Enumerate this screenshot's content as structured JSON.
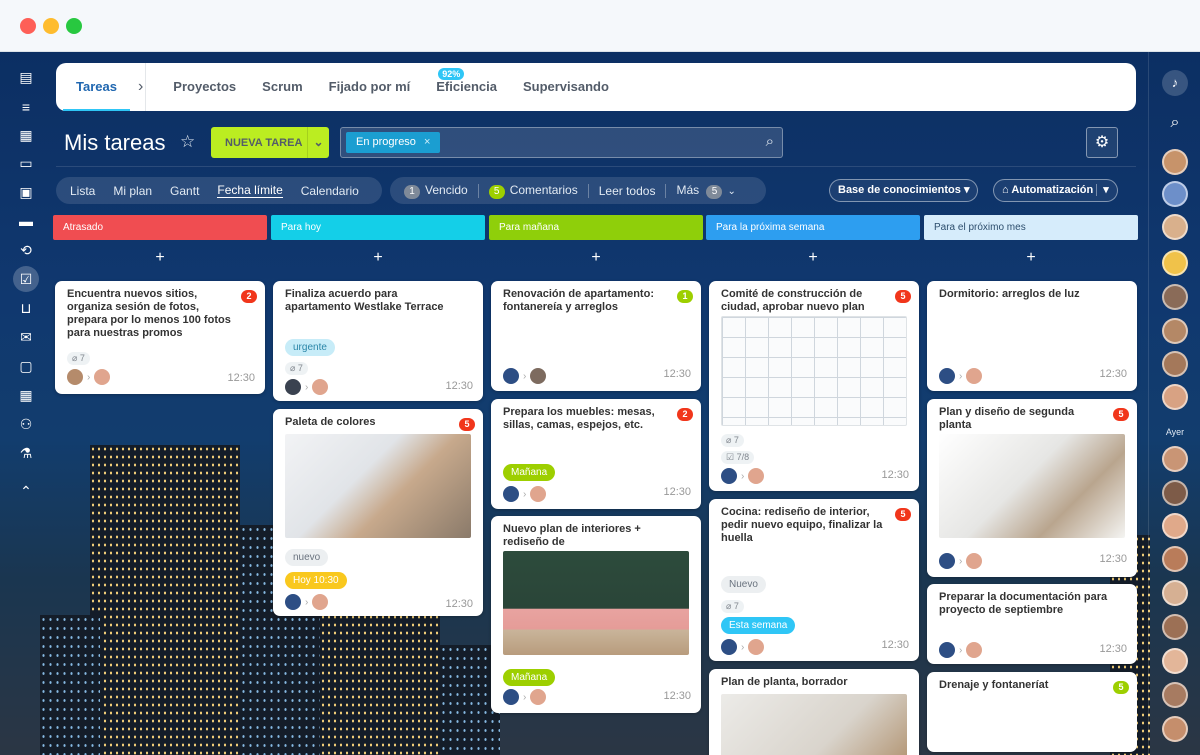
{
  "tabs": [
    {
      "label": "Tareas"
    },
    {
      "label": "Proyectos"
    },
    {
      "label": "Scrum"
    },
    {
      "label": "Fijado por mí"
    },
    {
      "label": "Eficiencia",
      "badge": "92%"
    },
    {
      "label": "Supervisando"
    }
  ],
  "header": {
    "title": "Mis tareas",
    "new_task": "NUEVA TAREA"
  },
  "search": {
    "chip": "En progreso"
  },
  "views": [
    "Lista",
    "Mi plan",
    "Gantt",
    "Fecha límite",
    "Calendario"
  ],
  "counters": {
    "vencido_count": "1",
    "vencido": "Vencido",
    "comentarios_count": "5",
    "comentarios": "Comentarios",
    "leer": "Leer todos",
    "mas": "Más",
    "mas_count": "5"
  },
  "buttons": {
    "kb": "Base de conocimientos",
    "auto": "Automatización"
  },
  "right_sidebar": {
    "label": "Ayer"
  },
  "columns": [
    {
      "title": "Atrasado",
      "color": "#f04d51"
    },
    {
      "title": "Para hoy",
      "color": "#14cfe8"
    },
    {
      "title": "Para mañana",
      "color": "#8fcf0a"
    },
    {
      "title": "Para la próxima semana",
      "color": "#2d9ef0"
    },
    {
      "title": "Para el próximo mes",
      "color": "#d6ecfb"
    }
  ],
  "cards": {
    "c1": {
      "title": "Encuentra nuevos sitios, organiza sesión de fotos, prepara por lo menos 100 fotos para nuestras promos",
      "count": "2",
      "attach": "7",
      "time": "12:30"
    },
    "c2": {
      "title": "Finaliza acuerdo para apartamento Westlake Terrace",
      "tag": "urgente",
      "attach": "7",
      "time": "12:30"
    },
    "c3": {
      "title": "Paleta de colores",
      "count": "5",
      "tag": "nuevo",
      "tag2": "Hoy 10:30",
      "time": "12:30"
    },
    "c4": {
      "title": "Renovación de apartamento: fontanereía y arreglos",
      "count": "1",
      "time": "12:30"
    },
    "c5": {
      "title": "Prepara los muebles: mesas, sillas, camas, espejos, etc.",
      "count": "2",
      "tag": "Mañana",
      "time": "12:30"
    },
    "c6": {
      "title": "Nuevo plan de interiores + rediseño de",
      "tag": "Mañana",
      "time": "12:30"
    },
    "c7": {
      "title": "Comité de construcción de ciudad, aprobar nuevo plan",
      "count": "5",
      "attach": "7",
      "check": "7/8",
      "time": "12:30"
    },
    "c8": {
      "title": "Cocina: rediseño de interior, pedir nuevo equipo, finalizar la huella",
      "count": "5",
      "tag": "Nuevo",
      "attach": "7",
      "tag2": "Esta semana",
      "time": "12:30"
    },
    "c9": {
      "title": "Plan de planta, borrador"
    },
    "c10": {
      "title": "Dormitorio: arreglos de luz",
      "time": "12:30"
    },
    "c11": {
      "title": "Plan y diseño de segunda planta",
      "count": "5",
      "time": "12:30"
    },
    "c12": {
      "title": "Preparar la documentación para proyecto de septiembre",
      "time": "12:30"
    },
    "c13": {
      "title": "Drenaje y fontaneríat",
      "count": "5"
    }
  }
}
